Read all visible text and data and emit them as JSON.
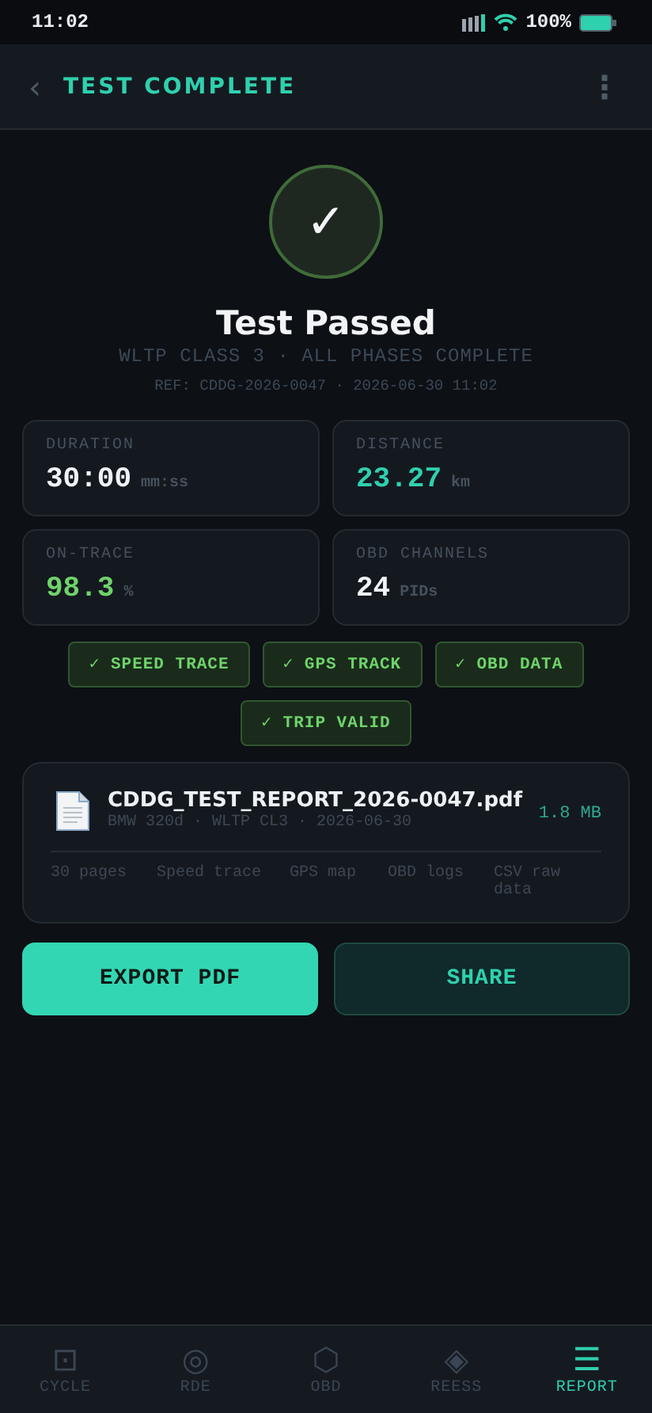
{
  "status_bar": {
    "time": "11:02",
    "battery": "100%"
  },
  "header": {
    "back": "‹",
    "title": "TEST COMPLETE",
    "menu": "⋮"
  },
  "result": {
    "check": "✓",
    "title": "Test Passed",
    "subtitle": "WLTP CLASS 3 · ALL PHASES COMPLETE",
    "ref": "REF: CDDG-2026-0047 · 2026-06-30 11:02"
  },
  "stats": [
    {
      "label": "DURATION",
      "value": "30:00",
      "unit": "mm:ss",
      "color": "#f0f3f6"
    },
    {
      "label": "DISTANCE",
      "value": "23.27",
      "unit": "km",
      "color": "#2fd0ad"
    },
    {
      "label": "ON-TRACE",
      "value": "98.3",
      "unit": "%",
      "color": "#6fd36a"
    },
    {
      "label": "OBD CHANNELS",
      "value": "24",
      "unit": "PIDs",
      "color": "#f0f3f6"
    }
  ],
  "chips": [
    "✓ SPEED TRACE",
    "✓ GPS TRACK",
    "✓ OBD DATA",
    "✓ TRIP VALID"
  ],
  "report": {
    "filename": "CDDG_TEST_REPORT_2026-0047.pdf",
    "meta": "BMW 320d · WLTP CL3 · 2026-06-30",
    "size": "1.8 MB",
    "contents": [
      "30 pages",
      "Speed trace",
      "GPS map",
      "OBD logs",
      "CSV raw data"
    ]
  },
  "actions": [
    {
      "label": "EXPORT PDF",
      "kind": "primary"
    },
    {
      "label": "SHARE",
      "kind": "secondary"
    }
  ],
  "nav": [
    {
      "icon": "⊡",
      "label": "CYCLE",
      "selected": false
    },
    {
      "icon": "◎",
      "label": "RDE",
      "selected": false
    },
    {
      "icon": "⬡",
      "label": "OBD",
      "selected": false
    },
    {
      "icon": "◈",
      "label": "REESS",
      "selected": false
    },
    {
      "icon": "☰",
      "label": "REPORT",
      "selected": true
    }
  ]
}
